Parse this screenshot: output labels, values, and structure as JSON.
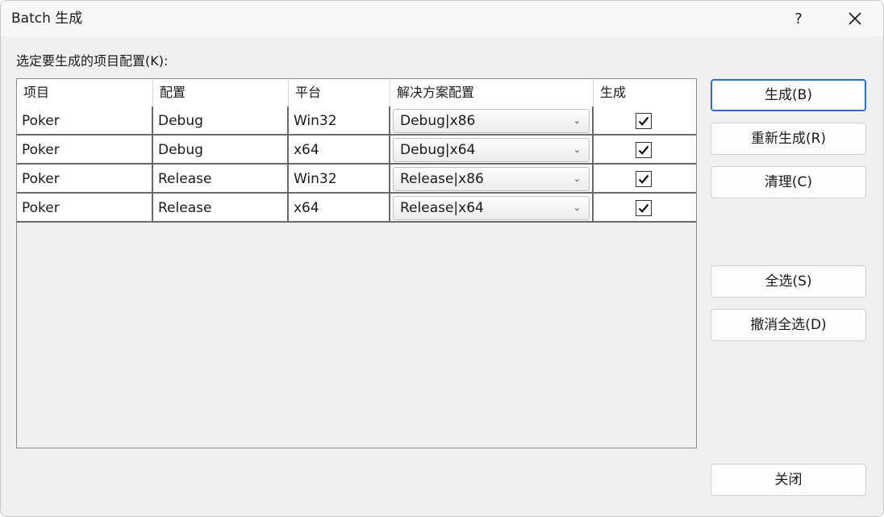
{
  "window": {
    "title": "Batch 生成",
    "help_label": "?",
    "close_icon": "close-icon"
  },
  "prompt": "选定要生成的项目配置(K):",
  "grid": {
    "columns": [
      "项目",
      "配置",
      "平台",
      "解决方案配置",
      "生成"
    ],
    "rows": [
      {
        "project": "Poker",
        "config": "Debug",
        "platform": "Win32",
        "solution_config": "Debug|x86",
        "build": true
      },
      {
        "project": "Poker",
        "config": "Debug",
        "platform": "x64",
        "solution_config": "Debug|x64",
        "build": true
      },
      {
        "project": "Poker",
        "config": "Release",
        "platform": "Win32",
        "solution_config": "Release|x86",
        "build": true
      },
      {
        "project": "Poker",
        "config": "Release",
        "platform": "x64",
        "solution_config": "Release|x64",
        "build": true
      }
    ]
  },
  "buttons": {
    "build": "生成(B)",
    "rebuild": "重新生成(R)",
    "clean": "清理(C)",
    "select_all": "全选(S)",
    "deselect_all": "撤消全选(D)",
    "close": "关闭"
  },
  "colors": {
    "default_button_border": "#2b6cc4"
  }
}
